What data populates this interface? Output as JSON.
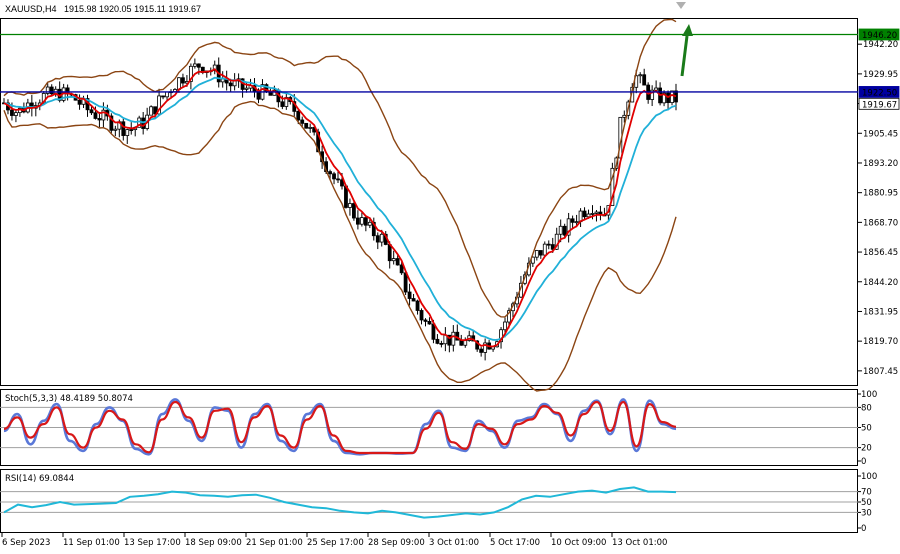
{
  "header": {
    "symbol_timeframe": "XAUUSD,H4",
    "ohlc": "1915.98 1920.05 1915.11 1919.67"
  },
  "colors": {
    "background": "#ffffff",
    "grid": "#c8c8c8",
    "candle": "#000000",
    "bollinger": "#8b4513",
    "ema_fast": "#e00000",
    "ema_slow": "#20b0d8",
    "resistance_green": "#008000",
    "resistance_blue": "#0000a0",
    "arrow": "#1a7a1a",
    "stoch_main": "#5a78d8",
    "stoch_signal": "#d81818",
    "rsi": "#20b8d8",
    "level_line": "#a0a0a0"
  },
  "chart_data": [
    {
      "type": "candlestick",
      "title": "XAUUSD,H4",
      "ylim": [
        1801.2,
        1953.0
      ],
      "y_ticks": [
        "1942.20",
        "1929.95",
        "1917.70",
        "1905.45",
        "1893.20",
        "1880.95",
        "1868.70",
        "1856.45",
        "1844.20",
        "1831.95",
        "1819.70",
        "1807.45"
      ],
      "x_tick_labels": [
        "6 Sep 2023",
        "11 Sep 01:00",
        "13 Sep 17:00",
        "18 Sep 09:00",
        "21 Sep 01:00",
        "25 Sep 17:00",
        "28 Sep 09:00",
        "3 Oct 01:00",
        "5 Oct 17:00",
        "10 Oct 09:00",
        "13 Oct 01:00"
      ],
      "close_path": [
        1918,
        1914,
        1919,
        1921,
        1922,
        1920,
        1915,
        1912,
        1909,
        1907,
        1910,
        1918,
        1925,
        1930,
        1934,
        1931,
        1926,
        1924,
        1923,
        1921,
        1918,
        1914,
        1905,
        1893,
        1882,
        1872,
        1866,
        1862,
        1850,
        1838,
        1828,
        1822,
        1820,
        1819,
        1818,
        1820,
        1830,
        1845,
        1855,
        1860,
        1865,
        1872,
        1876,
        1872,
        1908,
        1930,
        1922,
        1920,
        1919.67
      ],
      "price_labels": [
        {
          "label": "1946.20",
          "value": 1946.2,
          "color": "#008000"
        },
        {
          "label": "1922.50",
          "value": 1922.5,
          "color": "#0000a0"
        },
        {
          "label": "1919.67",
          "value": 1919.67,
          "color": "#000000"
        }
      ]
    },
    {
      "type": "line",
      "title": "Stoch(5,3,3) 48.4189 50.8074",
      "ylim": [
        0,
        100
      ],
      "levels": [
        80,
        50,
        20
      ],
      "y_ticks": [
        "100",
        "80",
        "50",
        "20",
        "0"
      ],
      "series": [
        {
          "name": "Stoch main",
          "last": 48.4189,
          "values": [
            45,
            70,
            25,
            60,
            85,
            30,
            15,
            55,
            80,
            60,
            18,
            10,
            70,
            92,
            60,
            30,
            80,
            75,
            20,
            70,
            85,
            30,
            15,
            70,
            85,
            30,
            12,
            10,
            12,
            12,
            11,
            12,
            55,
            75,
            20,
            15,
            60,
            45,
            20,
            60,
            65,
            85,
            70,
            30,
            75,
            90,
            40,
            92,
            15,
            90,
            55,
            48
          ]
        },
        {
          "name": "Stoch signal",
          "last": 50.8074,
          "values": [
            48,
            65,
            35,
            55,
            80,
            40,
            20,
            50,
            75,
            62,
            25,
            13,
            62,
            88,
            65,
            35,
            75,
            78,
            28,
            65,
            82,
            38,
            20,
            62,
            82,
            38,
            15,
            12,
            12,
            12,
            12,
            12,
            48,
            72,
            28,
            18,
            55,
            48,
            25,
            55,
            62,
            82,
            72,
            38,
            70,
            88,
            45,
            88,
            22,
            85,
            58,
            51
          ]
        }
      ]
    },
    {
      "type": "line",
      "title": "RSI(14) 69.0844",
      "ylim": [
        0,
        100
      ],
      "levels": [
        70,
        50,
        30
      ],
      "y_ticks": [
        "100",
        "70",
        "50",
        "30",
        "0"
      ],
      "series": [
        {
          "name": "RSI",
          "last": 69.0844,
          "values": [
            30,
            45,
            40,
            44,
            50,
            45,
            46,
            47,
            48,
            60,
            62,
            65,
            70,
            68,
            63,
            62,
            60,
            63,
            64,
            58,
            50,
            45,
            40,
            38,
            33,
            30,
            28,
            33,
            30,
            25,
            20,
            22,
            25,
            28,
            26,
            30,
            40,
            55,
            62,
            60,
            65,
            70,
            72,
            68,
            75,
            78,
            70,
            70,
            69.0844
          ]
        }
      ]
    }
  ]
}
